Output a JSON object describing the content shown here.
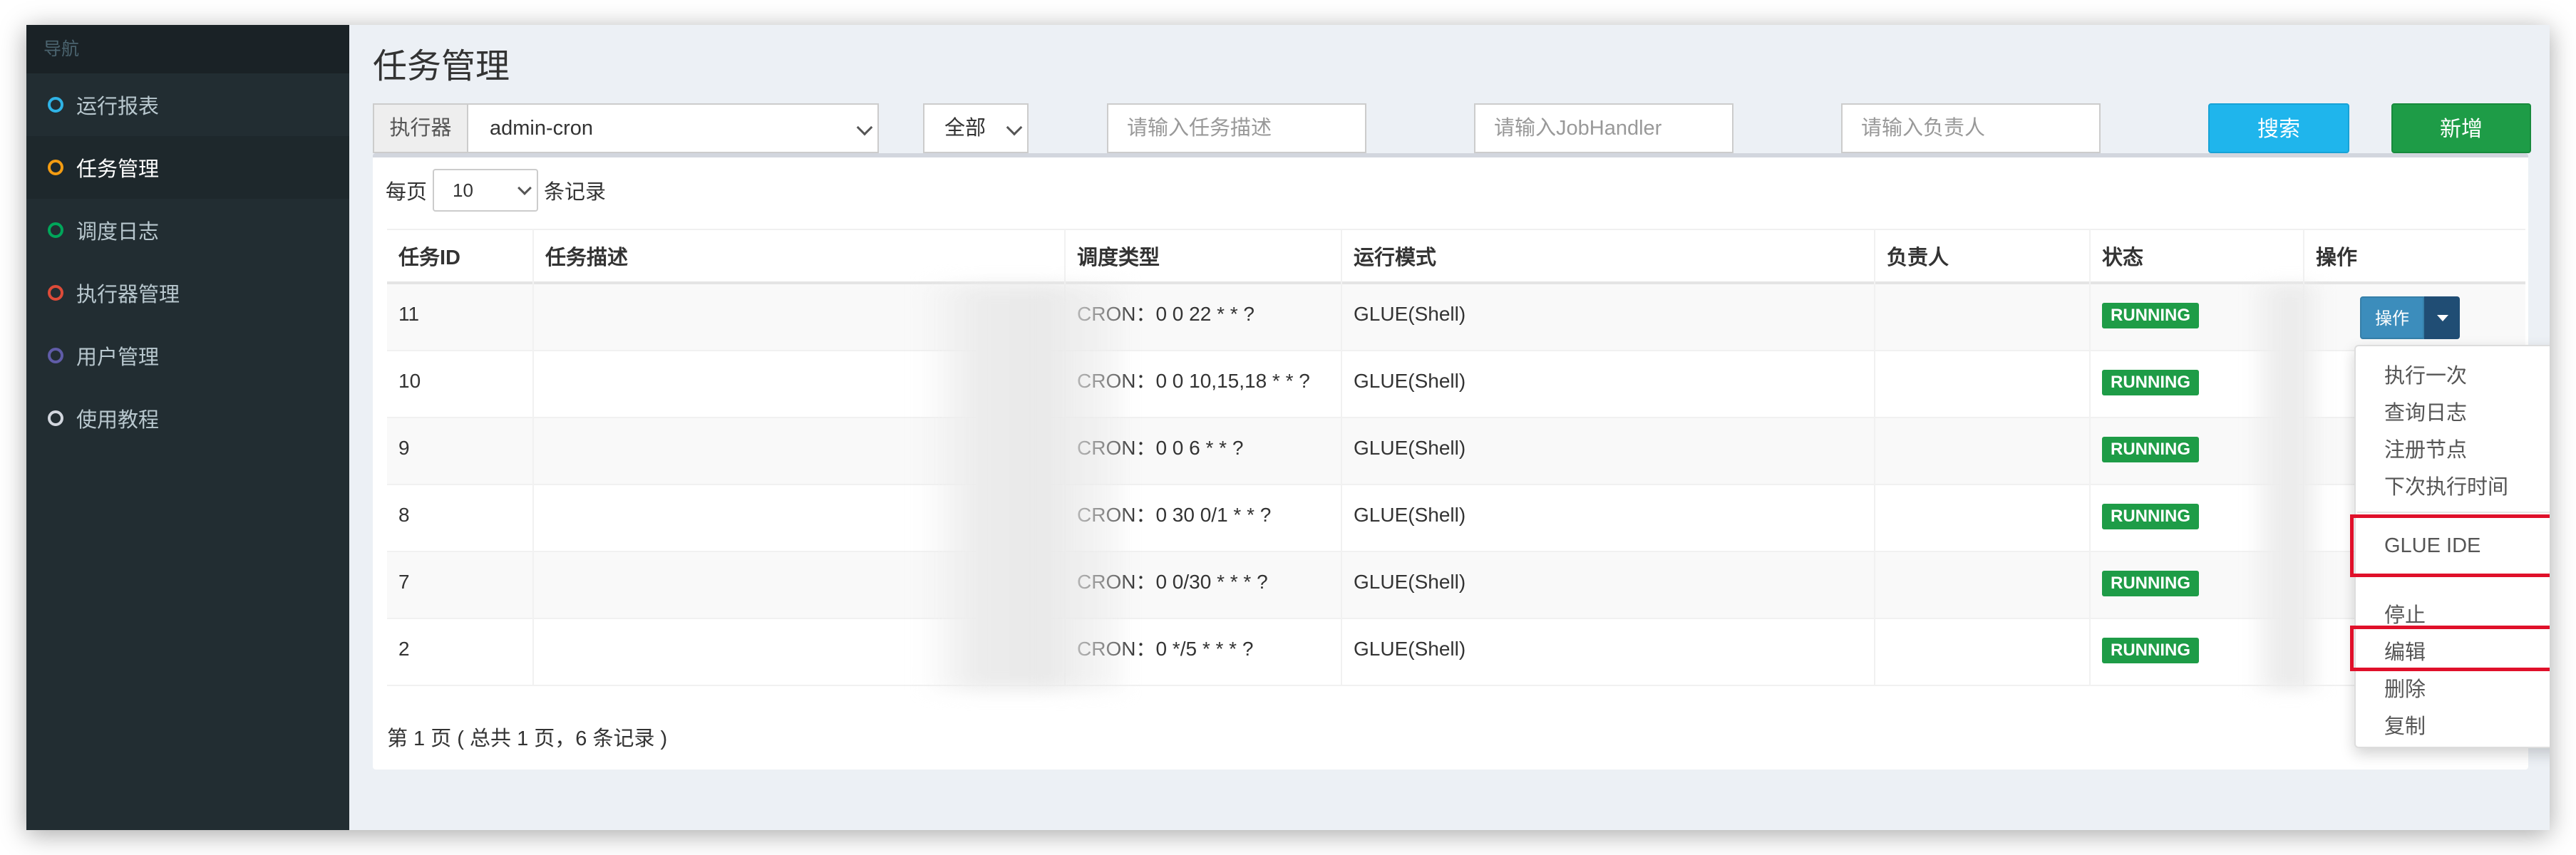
{
  "sidebar": {
    "header": "导航",
    "items": [
      {
        "label": "运行报表",
        "color": "#2fb3e6"
      },
      {
        "label": "任务管理",
        "color": "#f39c12",
        "active": true
      },
      {
        "label": "调度日志",
        "color": "#00a65a"
      },
      {
        "label": "执行器管理",
        "color": "#dd4b39"
      },
      {
        "label": "用户管理",
        "color": "#605ca8"
      },
      {
        "label": "使用教程",
        "color": "#d2d6de"
      }
    ]
  },
  "page": {
    "title": "任务管理"
  },
  "filters": {
    "executor_label": "执行器",
    "executor_value": "admin-cron",
    "status_value": "全部",
    "desc_placeholder": "请输入任务描述",
    "handler_placeholder": "请输入JobHandler",
    "author_placeholder": "请输入负责人",
    "search_label": "搜索",
    "add_label": "新增"
  },
  "perpage": {
    "prefix": "每页",
    "value": "10",
    "suffix": "条记录"
  },
  "table": {
    "headers": [
      "任务ID",
      "任务描述",
      "调度类型",
      "运行模式",
      "负责人",
      "状态",
      "操作"
    ],
    "rows": [
      {
        "id": "11",
        "desc": "",
        "schedule": "CRON：0 0 22 * * ?",
        "mode": "GLUE(Shell)",
        "author": "",
        "status": "RUNNING"
      },
      {
        "id": "10",
        "desc": "",
        "schedule": "CRON：0 0 10,15,18 * * ?",
        "mode": "GLUE(Shell)",
        "author": "",
        "status": "RUNNING"
      },
      {
        "id": "9",
        "desc": "",
        "schedule": "CRON：0 0 6 * * ?",
        "mode": "GLUE(Shell)",
        "author": "",
        "status": "RUNNING"
      },
      {
        "id": "8",
        "desc": "",
        "schedule": "CRON：0 30 0/1 * * ?",
        "mode": "GLUE(Shell)",
        "author": "",
        "status": "RUNNING"
      },
      {
        "id": "7",
        "desc": "",
        "schedule": "CRON：0 0/30 * * * ?",
        "mode": "GLUE(Shell)",
        "author": "",
        "status": "RUNNING"
      },
      {
        "id": "2",
        "desc": "",
        "schedule": "CRON：0 */5 * * * ?",
        "mode": "GLUE(Shell)",
        "author": "",
        "status": "RUNNING"
      }
    ]
  },
  "pager": {
    "text": "第 1 页 ( 总共 1 页，6 条记录 )"
  },
  "operation": {
    "button_label": "操作",
    "menu": [
      "执行一次",
      "查询日志",
      "注册节点",
      "下次执行时间",
      "GLUE IDE",
      "停止",
      "编辑",
      "删除",
      "复制"
    ]
  },
  "colors": {
    "highlight": "#e0102a",
    "running_badge": "#1e9c47"
  }
}
